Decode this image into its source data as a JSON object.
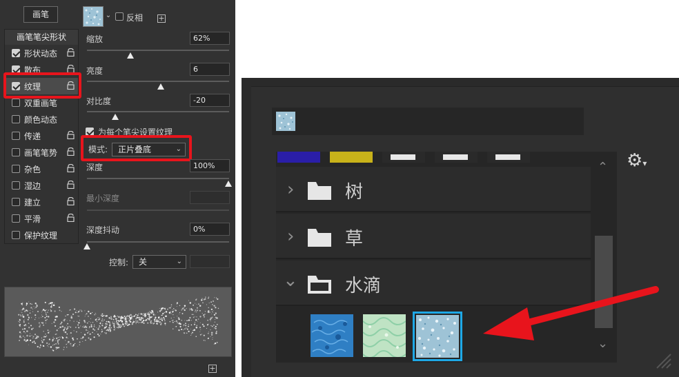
{
  "left_panel": {
    "brush_button": "画笔",
    "invert_label": "反相",
    "list_header": "画笔笔尖形状",
    "items": [
      {
        "label": "形状动态",
        "checked": true
      },
      {
        "label": "散布",
        "checked": true
      },
      {
        "label": "纹理",
        "checked": true
      },
      {
        "label": "双重画笔",
        "checked": false
      },
      {
        "label": "颜色动态",
        "checked": false
      },
      {
        "label": "传递",
        "checked": false
      },
      {
        "label": "画笔笔势",
        "checked": false
      },
      {
        "label": "杂色",
        "checked": false
      },
      {
        "label": "湿边",
        "checked": false
      },
      {
        "label": "建立",
        "checked": false
      },
      {
        "label": "平滑",
        "checked": false
      },
      {
        "label": "保护纹理",
        "checked": false
      }
    ],
    "scale": {
      "label": "缩放",
      "value": "62%"
    },
    "brightness": {
      "label": "亮度",
      "value": "6"
    },
    "contrast": {
      "label": "对比度",
      "value": "-20"
    },
    "per_tip_label": "为每个笔尖设置纹理",
    "mode": {
      "label": "模式:",
      "value": "正片叠底"
    },
    "depth": {
      "label": "深度",
      "value": "100%"
    },
    "min_depth": {
      "label": "最小深度",
      "value": ""
    },
    "depth_jitter": {
      "label": "深度抖动",
      "value": "0%"
    },
    "control": {
      "label": "控制:",
      "value": "关"
    }
  },
  "right_panel": {
    "groups": [
      {
        "name": "树",
        "expanded": false
      },
      {
        "name": "草",
        "expanded": false
      },
      {
        "name": "水滴",
        "expanded": true
      }
    ]
  },
  "colors": {
    "highlight": "#e8141c",
    "selected_border": "#1ea8e6"
  }
}
